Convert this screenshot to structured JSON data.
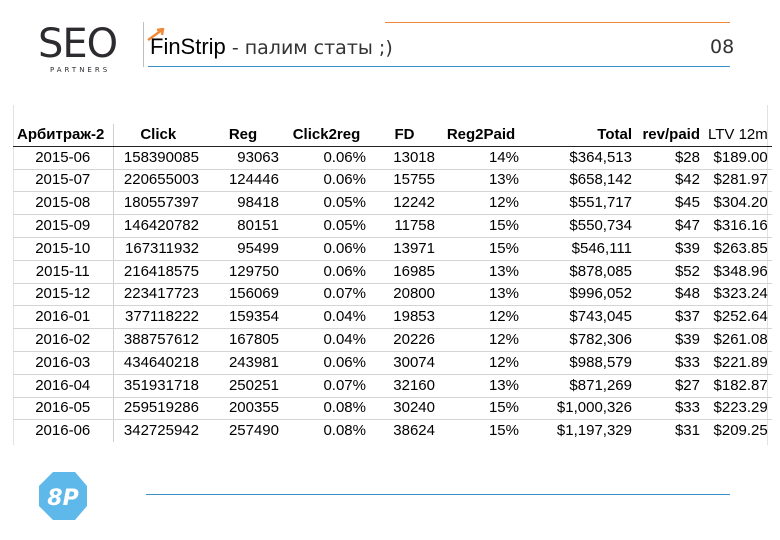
{
  "header": {
    "logo_main": "SEO",
    "logo_sub": "PARTNERS",
    "title_main": "FinStrip",
    "title_rest": " - палим статы ;)",
    "page_number": "08"
  },
  "table": {
    "columns": [
      "Арбитраж-2",
      "Click",
      "Reg",
      "Click2reg",
      "FD",
      "Reg2Paid",
      "Total",
      "rev/paid",
      "LTV 12m"
    ],
    "rows": [
      [
        "2015-06",
        "158390085",
        "93063",
        "0.06%",
        "13018",
        "14%",
        "$364,513",
        "$28",
        "$189.00"
      ],
      [
        "2015-07",
        "220655003",
        "124446",
        "0.06%",
        "15755",
        "13%",
        "$658,142",
        "$42",
        "$281.97"
      ],
      [
        "2015-08",
        "180557397",
        "98418",
        "0.05%",
        "12242",
        "12%",
        "$551,717",
        "$45",
        "$304.20"
      ],
      [
        "2015-09",
        "146420782",
        "80151",
        "0.05%",
        "11758",
        "15%",
        "$550,734",
        "$47",
        "$316.16"
      ],
      [
        "2015-10",
        "167311932",
        "95499",
        "0.06%",
        "13971",
        "15%",
        "$546,111",
        "$39",
        "$263.85"
      ],
      [
        "2015-11",
        "216418575",
        "129750",
        "0.06%",
        "16985",
        "13%",
        "$878,085",
        "$52",
        "$348.96"
      ],
      [
        "2015-12",
        "223417723",
        "156069",
        "0.07%",
        "20800",
        "13%",
        "$996,052",
        "$48",
        "$323.24"
      ],
      [
        "2016-01",
        "377118222",
        "159354",
        "0.04%",
        "19853",
        "12%",
        "$743,045",
        "$37",
        "$252.64"
      ],
      [
        "2016-02",
        "388757612",
        "167805",
        "0.04%",
        "20226",
        "12%",
        "$782,306",
        "$39",
        "$261.08"
      ],
      [
        "2016-03",
        "434640218",
        "243981",
        "0.06%",
        "30074",
        "12%",
        "$988,579",
        "$33",
        "$221.89"
      ],
      [
        "2016-04",
        "351931718",
        "250251",
        "0.07%",
        "32160",
        "13%",
        "$871,269",
        "$27",
        "$182.87"
      ],
      [
        "2016-05",
        "259519286",
        "200355",
        "0.08%",
        "30240",
        "15%",
        "$1,000,326",
        "$33",
        "$223.29"
      ],
      [
        "2016-06",
        "342725942",
        "257490",
        "0.08%",
        "38624",
        "15%",
        "$1,197,329",
        "$31",
        "$209.25"
      ]
    ]
  },
  "footer": {
    "badge": "8P"
  },
  "colors": {
    "accent_orange": "#f08a3a",
    "accent_blue": "#3a8fc7",
    "badge_blue": "#5fb8ea"
  }
}
